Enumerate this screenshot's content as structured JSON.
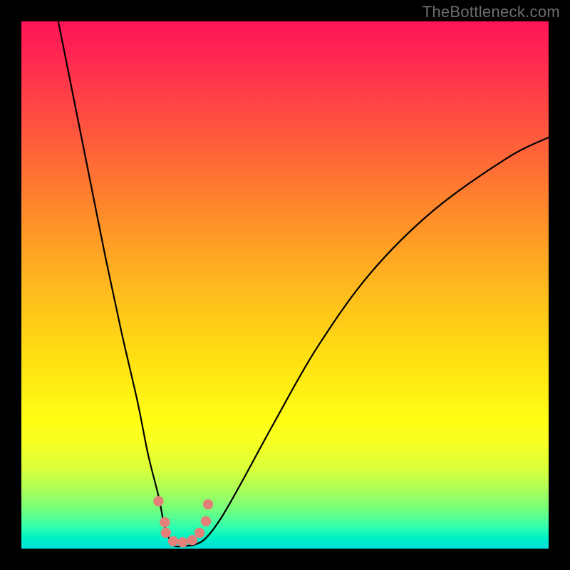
{
  "watermark": "TheBottleneck.com",
  "chart_data": {
    "type": "line",
    "title": "",
    "xlabel": "",
    "ylabel": "",
    "xlim": [
      0,
      100
    ],
    "ylim": [
      0,
      100
    ],
    "gradient_stops": [
      {
        "pos": 0,
        "color": "#ff1456"
      },
      {
        "pos": 22,
        "color": "#ff5a3c"
      },
      {
        "pos": 50,
        "color": "#ffb81e"
      },
      {
        "pos": 76,
        "color": "#ffff14"
      },
      {
        "pos": 93,
        "color": "#6cff82"
      },
      {
        "pos": 100,
        "color": "#00e0d8"
      }
    ],
    "series": [
      {
        "name": "bottleneck-curve",
        "x": [
          7,
          10,
          13,
          16,
          19,
          22,
          24,
          26,
          27,
          28,
          29,
          31,
          33,
          35,
          38,
          42,
          48,
          56,
          66,
          78,
          92,
          100
        ],
        "y": [
          100,
          85,
          70,
          55,
          41,
          28,
          18,
          10,
          5,
          2,
          0.5,
          0.5,
          0.8,
          2,
          6,
          13,
          24,
          38,
          52,
          64,
          74,
          78
        ]
      }
    ],
    "markers": {
      "name": "highlight-points",
      "color": "#e48079",
      "x": [
        26.0,
        27.2,
        27.4,
        28.8,
        30.6,
        32.4,
        33.8,
        35.0,
        35.4
      ],
      "y": [
        9.0,
        5.0,
        3.0,
        1.4,
        1.2,
        1.6,
        3.0,
        5.2,
        8.4
      ]
    }
  }
}
